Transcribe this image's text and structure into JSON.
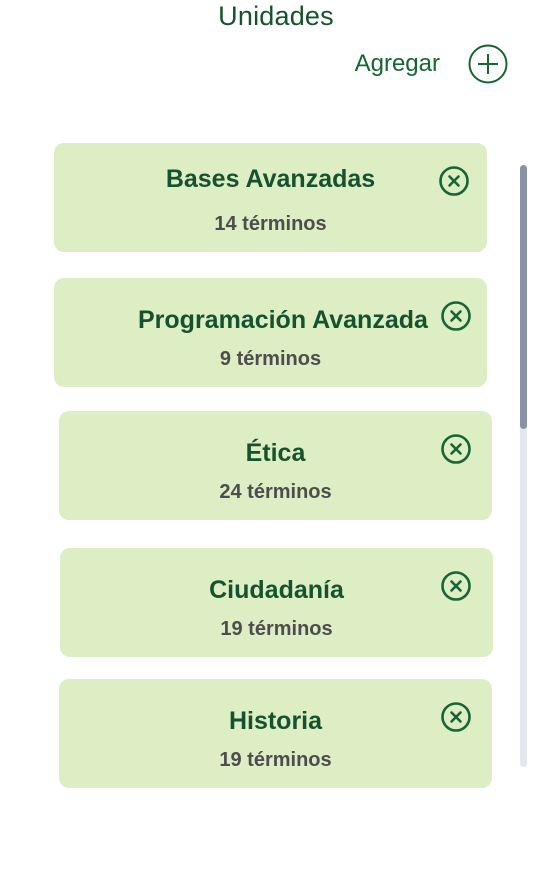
{
  "header": {
    "title": "Unidades",
    "add_label": "Agregar",
    "add_icon": "plus-circle-icon"
  },
  "units": [
    {
      "name": "Bases Avanzadas",
      "terms": "14 términos"
    },
    {
      "name": "Programación Avanzada",
      "terms": "9 términos"
    },
    {
      "name": "Ética",
      "terms": "24 términos"
    },
    {
      "name": "Ciudadanía",
      "terms": "19 términos"
    },
    {
      "name": "Historia",
      "terms": "19 términos"
    }
  ],
  "remove_icon": "close-circle-icon",
  "colors": {
    "accent": "#166534",
    "card_background": "#ddedc4",
    "subtitle_text": "#4d4d4d"
  }
}
